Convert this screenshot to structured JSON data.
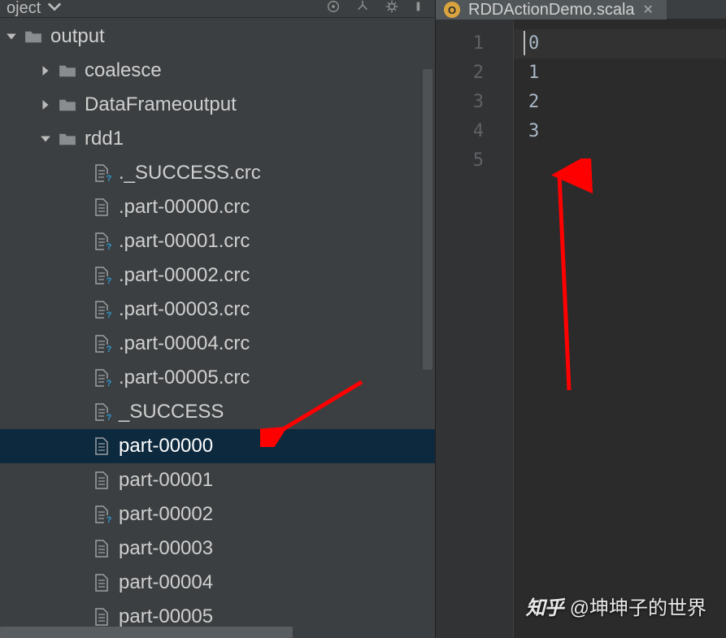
{
  "sidebar": {
    "panel_title": "oject",
    "tree": [
      {
        "kind": "folder",
        "label": "output",
        "depth": 0,
        "arrow": "down"
      },
      {
        "kind": "folder",
        "label": "coalesce",
        "depth": 1,
        "arrow": "right"
      },
      {
        "kind": "folder",
        "label": "DataFrameoutput",
        "depth": 1,
        "arrow": "right"
      },
      {
        "kind": "folder",
        "label": "rdd1",
        "depth": 1,
        "arrow": "down"
      },
      {
        "kind": "file-q",
        "label": "._SUCCESS.crc",
        "depth": 2
      },
      {
        "kind": "file",
        "label": ".part-00000.crc",
        "depth": 2
      },
      {
        "kind": "file-q",
        "label": ".part-00001.crc",
        "depth": 2
      },
      {
        "kind": "file-q",
        "label": ".part-00002.crc",
        "depth": 2
      },
      {
        "kind": "file-q",
        "label": ".part-00003.crc",
        "depth": 2
      },
      {
        "kind": "file-q",
        "label": ".part-00004.crc",
        "depth": 2
      },
      {
        "kind": "file-q",
        "label": ".part-00005.crc",
        "depth": 2
      },
      {
        "kind": "file-q",
        "label": "_SUCCESS",
        "depth": 2
      },
      {
        "kind": "file",
        "label": "part-00000",
        "depth": 2,
        "selected": true
      },
      {
        "kind": "file",
        "label": "part-00001",
        "depth": 2
      },
      {
        "kind": "file-q",
        "label": "part-00002",
        "depth": 2
      },
      {
        "kind": "file",
        "label": "part-00003",
        "depth": 2
      },
      {
        "kind": "file",
        "label": "part-00004",
        "depth": 2
      },
      {
        "kind": "file",
        "label": "part-00005",
        "depth": 2
      }
    ]
  },
  "editor": {
    "tab": {
      "label": "RDDActionDemo.scala",
      "icon_letter": "O"
    },
    "gutter": [
      "1",
      "2",
      "3",
      "4",
      "5"
    ],
    "lines": [
      "0",
      "1",
      "2",
      "3",
      ""
    ]
  },
  "watermark": {
    "logo": "知乎",
    "text": "@坤坤子的世界"
  },
  "annotation": {
    "color": "#ff0000"
  }
}
